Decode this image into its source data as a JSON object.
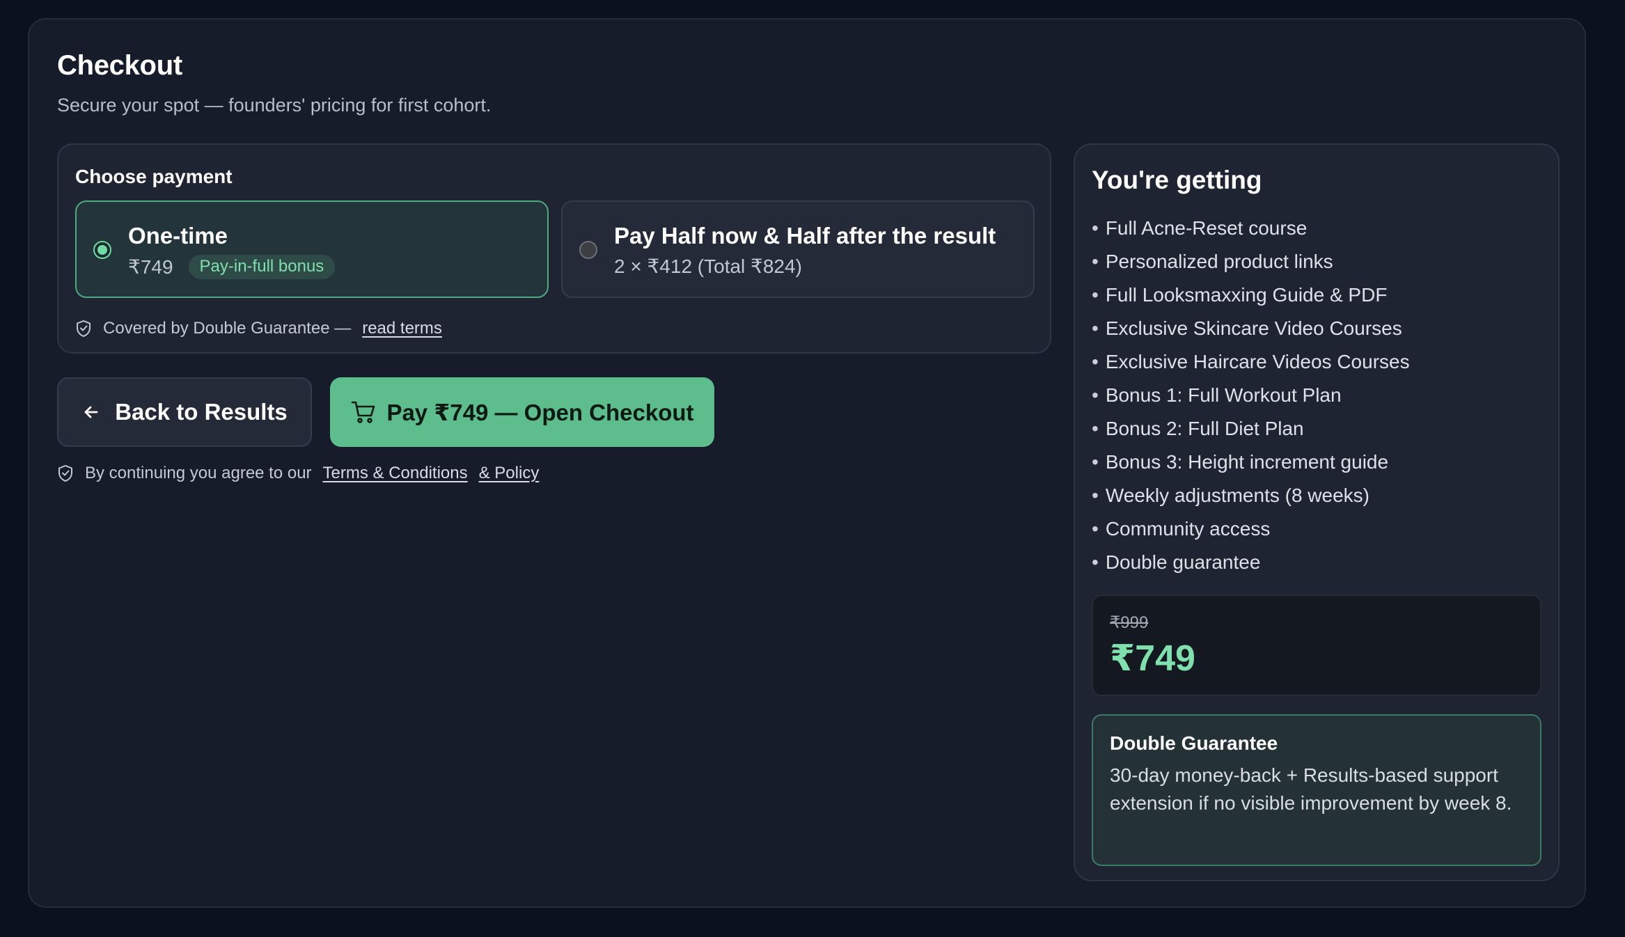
{
  "header": {
    "title": "Checkout",
    "subtitle": "Secure your spot — founders' pricing for first cohort."
  },
  "payment": {
    "title": "Choose payment",
    "options": [
      {
        "title": "One-time",
        "price": "₹749",
        "badge": "Pay-in-full bonus",
        "selected": true
      },
      {
        "title": "Pay Half now & Half after the result",
        "price": "2 × ₹412 (Total ₹824)",
        "selected": false
      }
    ],
    "guarantee_text": "Covered by Double Guarantee —",
    "terms_link": "read terms"
  },
  "actions": {
    "back_label": "Back to Results",
    "pay_label": "Pay ₹749 — Open Checkout"
  },
  "agreement": {
    "text": "By continuing you agree to our",
    "terms_link": "Terms & Conditions",
    "policy_link": "& Policy"
  },
  "summary": {
    "title": "You're getting",
    "items": [
      "Full Acne-Reset course",
      "Personalized product links",
      "Full Looksmaxxing Guide & PDF",
      "Exclusive Skincare Video Courses",
      "Exclusive Haircare Videos Courses",
      "Bonus 1: Full Workout Plan",
      "Bonus 2: Full Diet Plan",
      "Bonus 3: Height increment guide",
      "Weekly adjustments (8 weeks)",
      "Community access",
      "Double guarantee"
    ],
    "old_price": "₹999",
    "new_price": "₹749",
    "guarantee_title": "Double Guarantee",
    "guarantee_text": "30-day money-back + Results-based support extension if no visible improvement by week 8."
  },
  "colors": {
    "background": "#0c1120",
    "panel": "#171c2b",
    "card": "#1f2433",
    "accent": "#5dbd8c",
    "accent_text": "#7fe0ad"
  },
  "icons": {
    "guarantee": "shield-check-icon",
    "back": "arrow-left-icon",
    "pay": "cart-icon",
    "agreement": "shield-check-icon"
  }
}
